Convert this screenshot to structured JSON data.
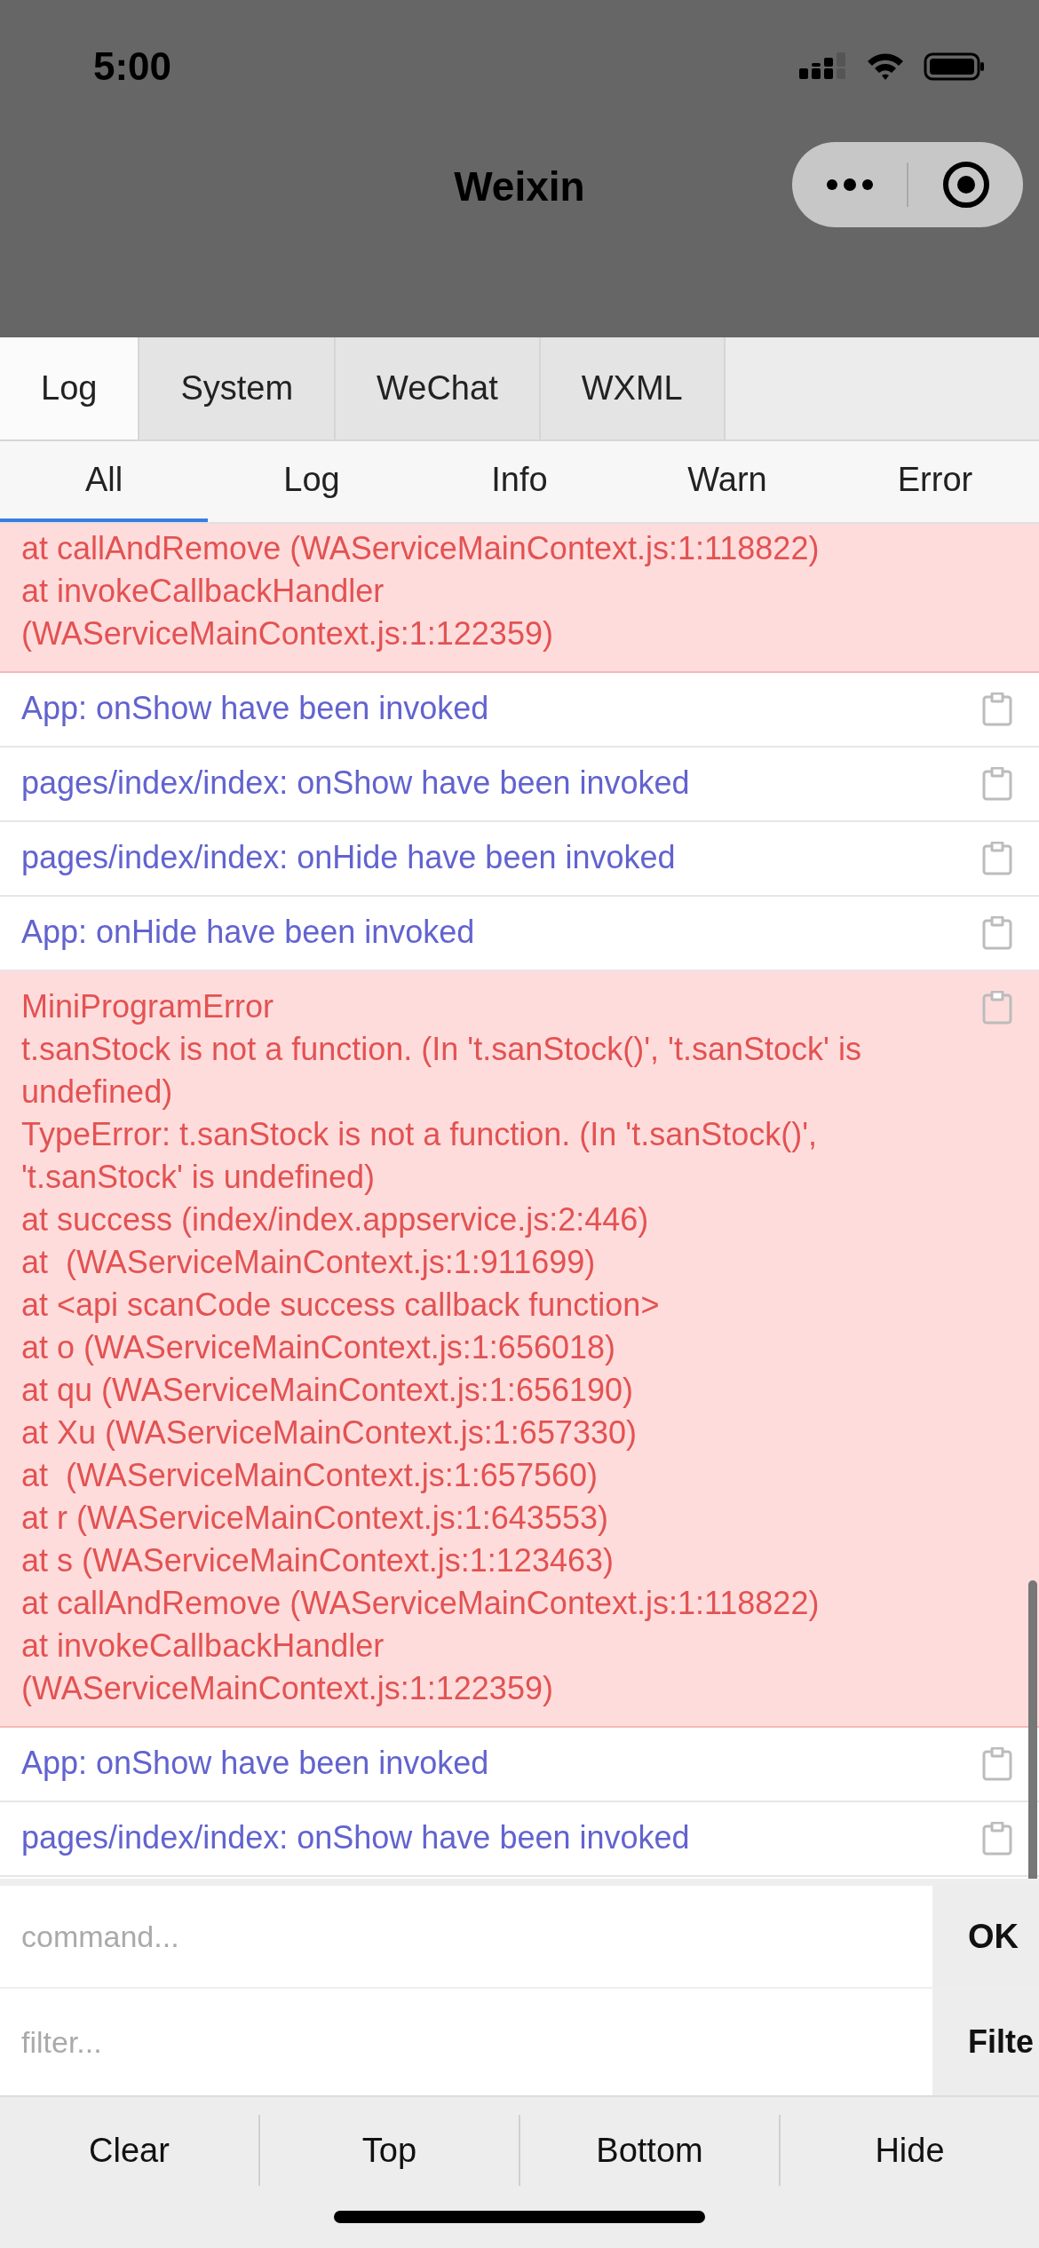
{
  "status_bar": {
    "time": "5:00"
  },
  "nav_bar": {
    "title": "Weixin"
  },
  "panel_tabs": [
    {
      "label": "Log",
      "selected": true
    },
    {
      "label": "System",
      "selected": false
    },
    {
      "label": "WeChat",
      "selected": false
    },
    {
      "label": "WXML",
      "selected": false
    }
  ],
  "level_tabs": [
    {
      "label": "All",
      "selected": true
    },
    {
      "label": "Log",
      "selected": false
    },
    {
      "label": "Info",
      "selected": false
    },
    {
      "label": "Warn",
      "selected": false
    },
    {
      "label": "Error",
      "selected": false
    }
  ],
  "entries": [
    {
      "kind": "error",
      "copy_icon": false,
      "lines": [
        "at callAndRemove (WAServiceMainContext.js:1:118822)",
        "at invokeCallbackHandler",
        "(WAServiceMainContext.js:1:122359)"
      ]
    },
    {
      "kind": "log",
      "copy_icon": true,
      "lines": [
        "App: onShow have been invoked"
      ]
    },
    {
      "kind": "log",
      "copy_icon": true,
      "lines": [
        "pages/index/index: onShow have been invoked"
      ]
    },
    {
      "kind": "log",
      "copy_icon": true,
      "lines": [
        "pages/index/index: onHide have been invoked"
      ]
    },
    {
      "kind": "log",
      "copy_icon": true,
      "lines": [
        "App: onHide have been invoked"
      ]
    },
    {
      "kind": "error",
      "copy_icon": true,
      "lines": [
        "MiniProgramError",
        "t.sanStock is not a function. (In 't.sanStock()', 't.sanStock' is",
        "undefined)",
        "TypeError: t.sanStock is not a function. (In 't.sanStock()',",
        "'t.sanStock' is undefined)",
        "at success (index/index.appservice.js:2:446)",
        "at  (WAServiceMainContext.js:1:911699)",
        "at <api scanCode success callback function>",
        "at o (WAServiceMainContext.js:1:656018)",
        "at qu (WAServiceMainContext.js:1:656190)",
        "at Xu (WAServiceMainContext.js:1:657330)",
        "at  (WAServiceMainContext.js:1:657560)",
        "at r (WAServiceMainContext.js:1:643553)",
        "at s (WAServiceMainContext.js:1:123463)",
        "at callAndRemove (WAServiceMainContext.js:1:118822)",
        "at invokeCallbackHandler",
        "(WAServiceMainContext.js:1:122359)"
      ]
    },
    {
      "kind": "log",
      "copy_icon": true,
      "lines": [
        "App: onShow have been invoked"
      ]
    },
    {
      "kind": "log",
      "copy_icon": true,
      "lines": [
        "pages/index/index: onShow have been invoked"
      ]
    }
  ],
  "command": {
    "placeholder": "command...",
    "button": "OK"
  },
  "filter": {
    "placeholder": "filter...",
    "button": "Filte"
  },
  "actions": [
    "Clear",
    "Top",
    "Bottom",
    "Hide"
  ]
}
